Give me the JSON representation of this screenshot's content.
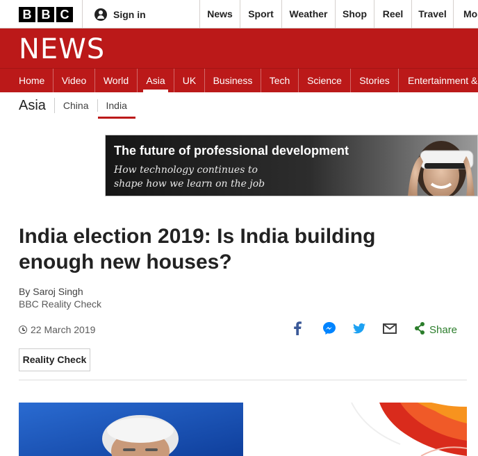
{
  "topbar": {
    "logo_letters": [
      "B",
      "B",
      "C"
    ],
    "signin_label": "Sign in",
    "nav": [
      "News",
      "Sport",
      "Weather",
      "Shop",
      "Reel",
      "Travel",
      "Mor"
    ]
  },
  "masthead": {
    "title": "NEWS"
  },
  "mainnav": {
    "items": [
      "Home",
      "Video",
      "World",
      "Asia",
      "UK",
      "Business",
      "Tech",
      "Science",
      "Stories",
      "Entertainment &"
    ],
    "active": "Asia"
  },
  "subnav": {
    "section": "Asia",
    "items": [
      "China",
      "India"
    ],
    "active": "India"
  },
  "ad": {
    "headline": "The future of professional development",
    "subtext": "How technology continues to shape how we learn on the job"
  },
  "article": {
    "headline": "India election 2019: Is India building enough new houses?",
    "author": "By Saroj Singh",
    "organisation": "BBC Reality Check",
    "date": "22 March 2019",
    "tag": "Reality Check"
  },
  "share": {
    "label": "Share",
    "icons": [
      "facebook-icon",
      "messenger-icon",
      "twitter-icon",
      "email-icon",
      "share-icon"
    ],
    "colors": {
      "facebook": "#3b5998",
      "messenger": "#0084ff",
      "twitter": "#1da1f2",
      "email": "#404040",
      "share": "#2b7d2b"
    }
  },
  "colors": {
    "brand_red": "#bb1919",
    "text": "#222222"
  }
}
